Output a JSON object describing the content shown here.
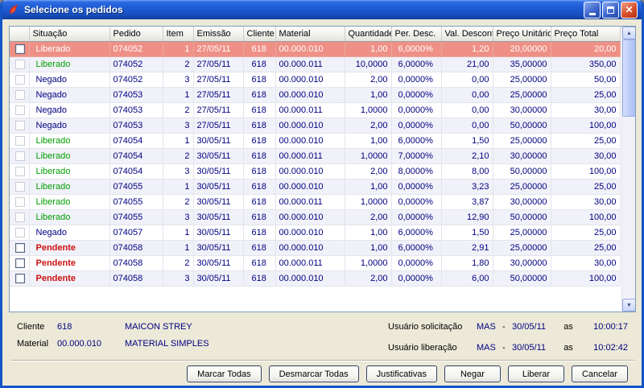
{
  "window": {
    "title": "Selecione os pedidos"
  },
  "table": {
    "columns": [
      "Situação",
      "Pedido",
      "Item",
      "Emissão",
      "Cliente",
      "Material",
      "Quantidade",
      "Per. Desc.",
      "Val. Desconto",
      "Preço Unitário",
      "Preço Total"
    ],
    "rows": [
      {
        "situacao": "Liberado",
        "status": "liberado",
        "selected": true,
        "checkbox": "active",
        "pedido": "074052",
        "item": "1",
        "emissao": "27/05/11",
        "cliente": "618",
        "material": "00.000.010",
        "quantidade": "1,00",
        "per_desc": "6,0000%",
        "val_desconto": "1,20",
        "preco_unitario": "20,00000",
        "preco_total": "20,00"
      },
      {
        "situacao": "Liberado",
        "status": "liberado",
        "selected": false,
        "checkbox": "flat",
        "pedido": "074052",
        "item": "2",
        "emissao": "27/05/11",
        "cliente": "618",
        "material": "00.000.011",
        "quantidade": "10,0000",
        "per_desc": "6,0000%",
        "val_desconto": "21,00",
        "preco_unitario": "35,00000",
        "preco_total": "350,00"
      },
      {
        "situacao": "Negado",
        "status": "negado",
        "selected": false,
        "checkbox": "flat",
        "pedido": "074052",
        "item": "3",
        "emissao": "27/05/11",
        "cliente": "618",
        "material": "00.000.010",
        "quantidade": "2,00",
        "per_desc": "0,0000%",
        "val_desconto": "0,00",
        "preco_unitario": "25,00000",
        "preco_total": "50,00"
      },
      {
        "situacao": "Negado",
        "status": "negado",
        "selected": false,
        "checkbox": "flat",
        "pedido": "074053",
        "item": "1",
        "emissao": "27/05/11",
        "cliente": "618",
        "material": "00.000.010",
        "quantidade": "1,00",
        "per_desc": "0,0000%",
        "val_desconto": "0,00",
        "preco_unitario": "25,00000",
        "preco_total": "25,00"
      },
      {
        "situacao": "Negado",
        "status": "negado",
        "selected": false,
        "checkbox": "flat",
        "pedido": "074053",
        "item": "2",
        "emissao": "27/05/11",
        "cliente": "618",
        "material": "00.000.011",
        "quantidade": "1,0000",
        "per_desc": "0,0000%",
        "val_desconto": "0,00",
        "preco_unitario": "30,00000",
        "preco_total": "30,00"
      },
      {
        "situacao": "Negado",
        "status": "negado",
        "selected": false,
        "checkbox": "flat",
        "pedido": "074053",
        "item": "3",
        "emissao": "27/05/11",
        "cliente": "618",
        "material": "00.000.010",
        "quantidade": "2,00",
        "per_desc": "0,0000%",
        "val_desconto": "0,00",
        "preco_unitario": "50,00000",
        "preco_total": "100,00"
      },
      {
        "situacao": "Liberado",
        "status": "liberado",
        "selected": false,
        "checkbox": "flat",
        "pedido": "074054",
        "item": "1",
        "emissao": "30/05/11",
        "cliente": "618",
        "material": "00.000.010",
        "quantidade": "1,00",
        "per_desc": "6,0000%",
        "val_desconto": "1,50",
        "preco_unitario": "25,00000",
        "preco_total": "25,00"
      },
      {
        "situacao": "Liberado",
        "status": "liberado",
        "selected": false,
        "checkbox": "flat",
        "pedido": "074054",
        "item": "2",
        "emissao": "30/05/11",
        "cliente": "618",
        "material": "00.000.011",
        "quantidade": "1,0000",
        "per_desc": "7,0000%",
        "val_desconto": "2,10",
        "preco_unitario": "30,00000",
        "preco_total": "30,00"
      },
      {
        "situacao": "Liberado",
        "status": "liberado",
        "selected": false,
        "checkbox": "flat",
        "pedido": "074054",
        "item": "3",
        "emissao": "30/05/11",
        "cliente": "618",
        "material": "00.000.010",
        "quantidade": "2,00",
        "per_desc": "8,0000%",
        "val_desconto": "8,00",
        "preco_unitario": "50,00000",
        "preco_total": "100,00"
      },
      {
        "situacao": "Liberado",
        "status": "liberado",
        "selected": false,
        "checkbox": "flat",
        "pedido": "074055",
        "item": "1",
        "emissao": "30/05/11",
        "cliente": "618",
        "material": "00.000.010",
        "quantidade": "1,00",
        "per_desc": "0,0000%",
        "val_desconto": "3,23",
        "preco_unitario": "25,00000",
        "preco_total": "25,00"
      },
      {
        "situacao": "Liberado",
        "status": "liberado",
        "selected": false,
        "checkbox": "flat",
        "pedido": "074055",
        "item": "2",
        "emissao": "30/05/11",
        "cliente": "618",
        "material": "00.000.011",
        "quantidade": "1,0000",
        "per_desc": "0,0000%",
        "val_desconto": "3,87",
        "preco_unitario": "30,00000",
        "preco_total": "30,00"
      },
      {
        "situacao": "Liberado",
        "status": "liberado",
        "selected": false,
        "checkbox": "flat",
        "pedido": "074055",
        "item": "3",
        "emissao": "30/05/11",
        "cliente": "618",
        "material": "00.000.010",
        "quantidade": "2,00",
        "per_desc": "0,0000%",
        "val_desconto": "12,90",
        "preco_unitario": "50,00000",
        "preco_total": "100,00"
      },
      {
        "situacao": "Negado",
        "status": "negado",
        "selected": false,
        "checkbox": "flat",
        "pedido": "074057",
        "item": "1",
        "emissao": "30/05/11",
        "cliente": "618",
        "material": "00.000.010",
        "quantidade": "1,00",
        "per_desc": "6,0000%",
        "val_desconto": "1,50",
        "preco_unitario": "25,00000",
        "preco_total": "25,00"
      },
      {
        "situacao": "Pendente",
        "status": "pendente",
        "selected": false,
        "checkbox": "active",
        "pedido": "074058",
        "item": "1",
        "emissao": "30/05/11",
        "cliente": "618",
        "material": "00.000.010",
        "quantidade": "1,00",
        "per_desc": "6,0000%",
        "val_desconto": "2,91",
        "preco_unitario": "25,00000",
        "preco_total": "25,00"
      },
      {
        "situacao": "Pendente",
        "status": "pendente",
        "selected": false,
        "checkbox": "active",
        "pedido": "074058",
        "item": "2",
        "emissao": "30/05/11",
        "cliente": "618",
        "material": "00.000.011",
        "quantidade": "1,0000",
        "per_desc": "0,0000%",
        "val_desconto": "1,80",
        "preco_unitario": "30,00000",
        "preco_total": "30,00"
      },
      {
        "situacao": "Pendente",
        "status": "pendente",
        "selected": false,
        "checkbox": "active",
        "pedido": "074058",
        "item": "3",
        "emissao": "30/05/11",
        "cliente": "618",
        "material": "00.000.010",
        "quantidade": "2,00",
        "per_desc": "0,0000%",
        "val_desconto": "6,00",
        "preco_unitario": "50,00000",
        "preco_total": "100,00"
      }
    ]
  },
  "footer": {
    "left": [
      {
        "label": "Cliente",
        "code": "618",
        "name": "MAICON STREY"
      },
      {
        "label": "Material",
        "code": "00.000.010",
        "name": "MATERIAL SIMPLES"
      }
    ],
    "right": [
      {
        "label": "Usuário solicitação",
        "user": "MAS",
        "sep": "-",
        "date": "30/05/11",
        "as": "as",
        "time": "10:00:17"
      },
      {
        "label": "Usuário liberação",
        "user": "MAS",
        "sep": "-",
        "date": "30/05/11",
        "as": "as",
        "time": "10:02:42"
      }
    ]
  },
  "buttons": [
    "Marcar Todas",
    "Desmarcar Todas",
    "Justificativas",
    "Negar",
    "Liberar",
    "Cancelar"
  ]
}
